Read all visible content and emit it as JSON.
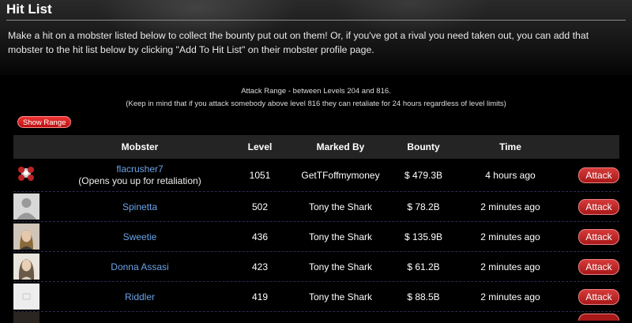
{
  "page": {
    "title": "Hit List",
    "intro": "Make a hit on a mobster listed below to collect the bounty put out on them! Or, if you've got a rival you need taken out, you can add that mobster to the hit list below by clicking \"Add To Hit List\" on their mobster profile page.",
    "range_text": "Attack Range - between Levels 204 and 816.",
    "range_note": "(Keep in mind that if you attack somebody above level 816 they can retaliate for 24 hours regardless of level limits)",
    "show_range_label": "Show Range"
  },
  "table": {
    "headers": [
      "Mobster",
      "Level",
      "Marked By",
      "Bounty",
      "Time"
    ],
    "attack_label": "Attack",
    "rows": [
      {
        "name": "flacrusher7",
        "note": "(Opens you up for retaliation)",
        "level": "1051",
        "marked_by": "GetTFoffmymoney",
        "bounty": "$ 479.3B",
        "time": "4 hours ago",
        "avatar": "flower-avatar-icon"
      },
      {
        "name": "Spinetta",
        "level": "502",
        "marked_by": "Tony the Shark",
        "bounty": "$ 78.2B",
        "time": "2 minutes ago",
        "avatar": "default-silhouette-avatar-icon"
      },
      {
        "name": "Sweetie",
        "level": "436",
        "marked_by": "Tony the Shark",
        "bounty": "$ 135.9B",
        "time": "2 minutes ago",
        "avatar": "woman-photo-avatar-icon"
      },
      {
        "name": "Donna Assasi",
        "level": "423",
        "marked_by": "Tony the Shark",
        "bounty": "$ 61.2B",
        "time": "2 minutes ago",
        "avatar": "woman-photo-avatar-icon"
      },
      {
        "name": "Riddler",
        "level": "419",
        "marked_by": "Tony the Shark",
        "bounty": "$ 88.5B",
        "time": "2 minutes ago",
        "avatar": "blank-avatar-icon"
      }
    ]
  }
}
